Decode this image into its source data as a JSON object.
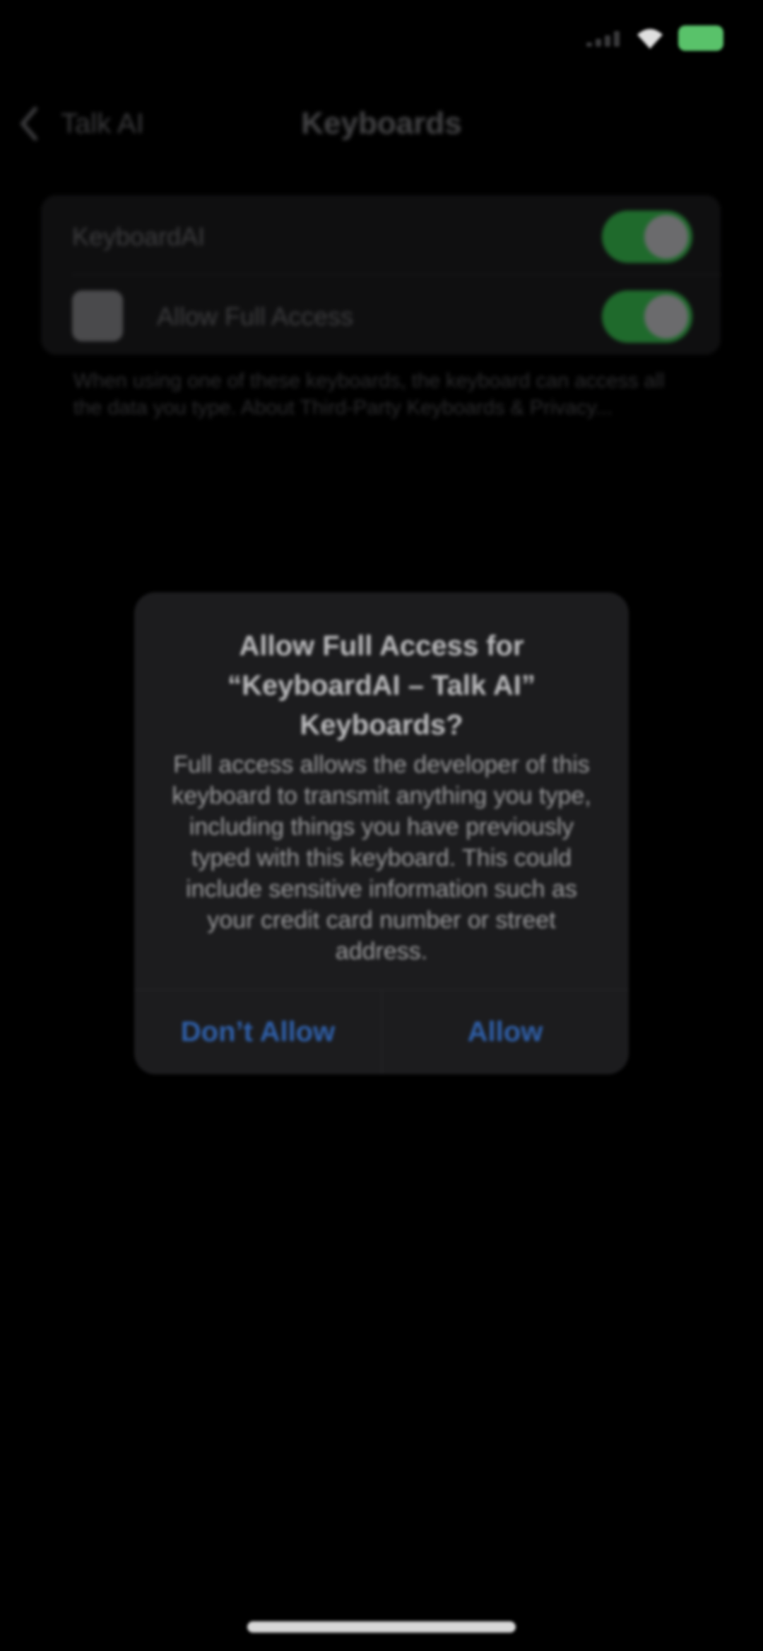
{
  "status_bar": {
    "time": "",
    "battery_color": "#59c26a",
    "icons": [
      "signal-icon",
      "wifi-icon",
      "battery-icon"
    ]
  },
  "nav": {
    "back_label": "Talk AI",
    "title": "Keyboards"
  },
  "settings": {
    "rows": [
      {
        "label": "KeyboardAI",
        "toggle_on": true
      },
      {
        "label": "Allow Full Access",
        "toggle_on": true,
        "icon": "app-icon"
      }
    ],
    "footer": "When using one of these keyboards, the keyboard can access all the data you type. About Third-Party Keyboards & Privacy..."
  },
  "alert": {
    "title": "Allow Full Access for “KeyboardAI – Talk AI” Keyboards?",
    "message": "Full access allows the developer of this keyboard to transmit anything you type, including things you have previously typed with this keyboard. This could include sensitive information such as your credit card number or street address.",
    "dont_allow_label": "Don’t Allow",
    "allow_label": "Allow",
    "button_color": "#2f5fa8"
  },
  "colors": {
    "background": "#000000",
    "toggle_on": "#1f6a2c",
    "alert_background": "#1c1c1e"
  }
}
